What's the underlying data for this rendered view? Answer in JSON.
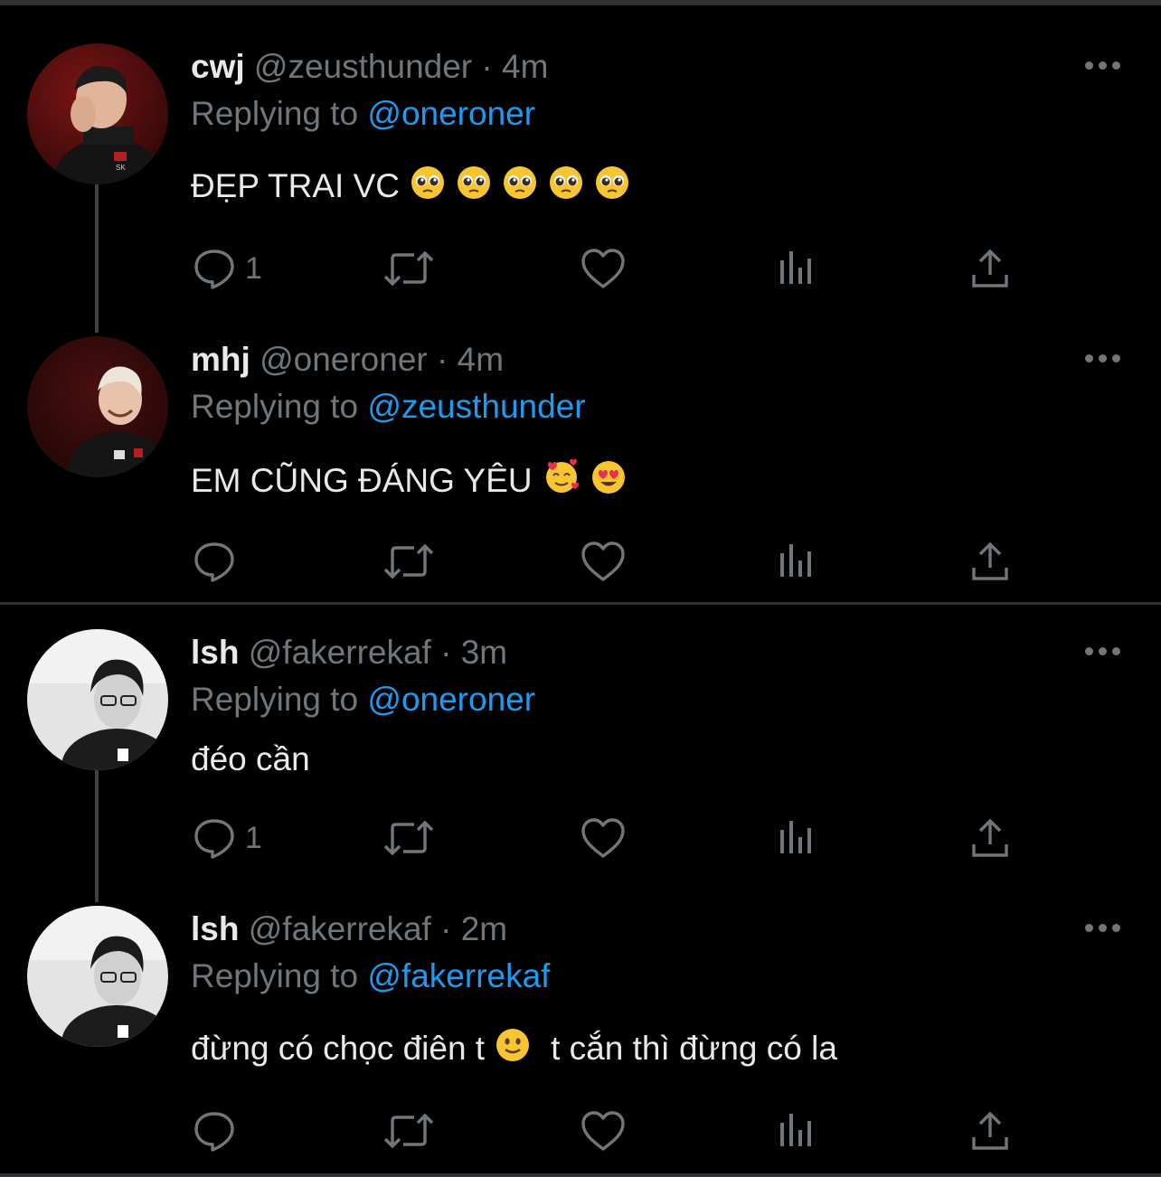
{
  "theme": {
    "background": "#000000",
    "text": "#e7e9ea",
    "muted": "#71767b",
    "accent": "#1d9bf0",
    "border": "#2f3336"
  },
  "tweets": [
    {
      "name": "cwj",
      "handle": "@zeusthunder",
      "time": "4m",
      "reply_prefix": "Replying to",
      "reply_to": "@oneroner",
      "text": "ĐẸP TRAI VC",
      "emojis": [
        "pleading-face-emoji",
        "pleading-face-emoji",
        "pleading-face-emoji",
        "pleading-face-emoji",
        "pleading-face-emoji"
      ],
      "reply_count": "1",
      "avatar": "cwj-avatar-photo"
    },
    {
      "name": "mhj",
      "handle": "@oneroner",
      "time": "4m",
      "reply_prefix": "Replying to",
      "reply_to": "@zeusthunder",
      "text": "EM CŨNG ĐÁNG YÊU",
      "emojis": [
        "smiling-face-with-hearts-emoji",
        "heart-eyes-emoji"
      ],
      "reply_count": "",
      "avatar": "mhj-avatar-photo"
    },
    {
      "name": "lsh",
      "handle": "@fakerrekaf",
      "time": "3m",
      "reply_prefix": "Replying to",
      "reply_to": "@oneroner",
      "text": "đéo cần",
      "emojis": [],
      "reply_count": "1",
      "avatar": "lsh-avatar-photo"
    },
    {
      "name": "lsh",
      "handle": "@fakerrekaf",
      "time": "2m",
      "reply_prefix": "Replying to",
      "reply_to": "@fakerrekaf",
      "text_before": "đừng có chọc điên t",
      "text_after": "t cắn thì đừng có la",
      "emojis": [
        "slightly-smiling-face-emoji"
      ],
      "reply_count": "",
      "avatar": "lsh-avatar-photo"
    }
  ],
  "action_icons": [
    "reply-icon",
    "retweet-icon",
    "like-icon",
    "analytics-icon",
    "share-icon"
  ],
  "dot_separator": "·"
}
